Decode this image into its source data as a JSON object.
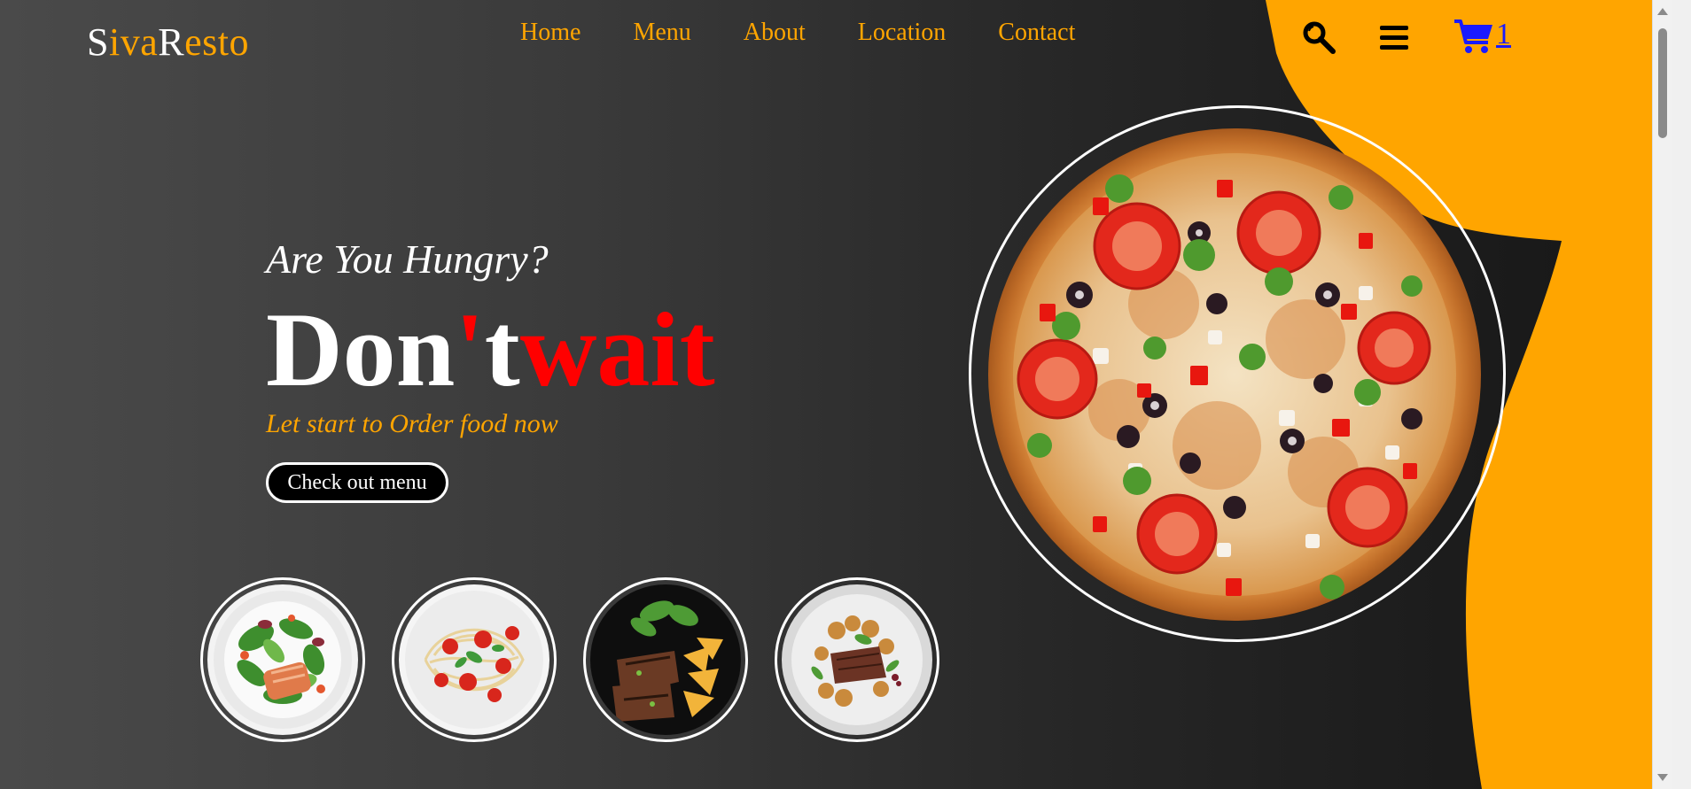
{
  "brand": {
    "logo_parts": [
      {
        "text": "S",
        "tone": "white"
      },
      {
        "text": "iva",
        "tone": "orange"
      },
      {
        "text": "R",
        "tone": "white"
      },
      {
        "text": "esto",
        "tone": "orange"
      }
    ]
  },
  "nav": {
    "items": [
      {
        "label": "Home"
      },
      {
        "label": "Menu"
      },
      {
        "label": "About"
      },
      {
        "label": "Location"
      },
      {
        "label": "Contact"
      }
    ]
  },
  "header_icons": {
    "search": "search-icon",
    "menu": "hamburger-menu-icon",
    "cart": "shopping-cart-icon",
    "cart_count": "1"
  },
  "hero": {
    "subtitle": "Are You Hungry?",
    "headline_white": "Don",
    "headline_apostrophe": "'",
    "headline_t": "t",
    "headline_red": "wait",
    "tagline": "Let start to Order food now",
    "cta_label": "Check out menu"
  },
  "thumbnails": [
    {
      "dish": "salmon-salad"
    },
    {
      "dish": "spaghetti-tomato"
    },
    {
      "dish": "steak-potato-wedges"
    },
    {
      "dish": "steak-roasted-potatoes"
    }
  ],
  "featured": {
    "dish": "pizza"
  },
  "colors": {
    "accent": "#ffa500",
    "headline_red": "#ff0000",
    "cart_blue": "#1a1aff",
    "background_dark": "#262626"
  }
}
